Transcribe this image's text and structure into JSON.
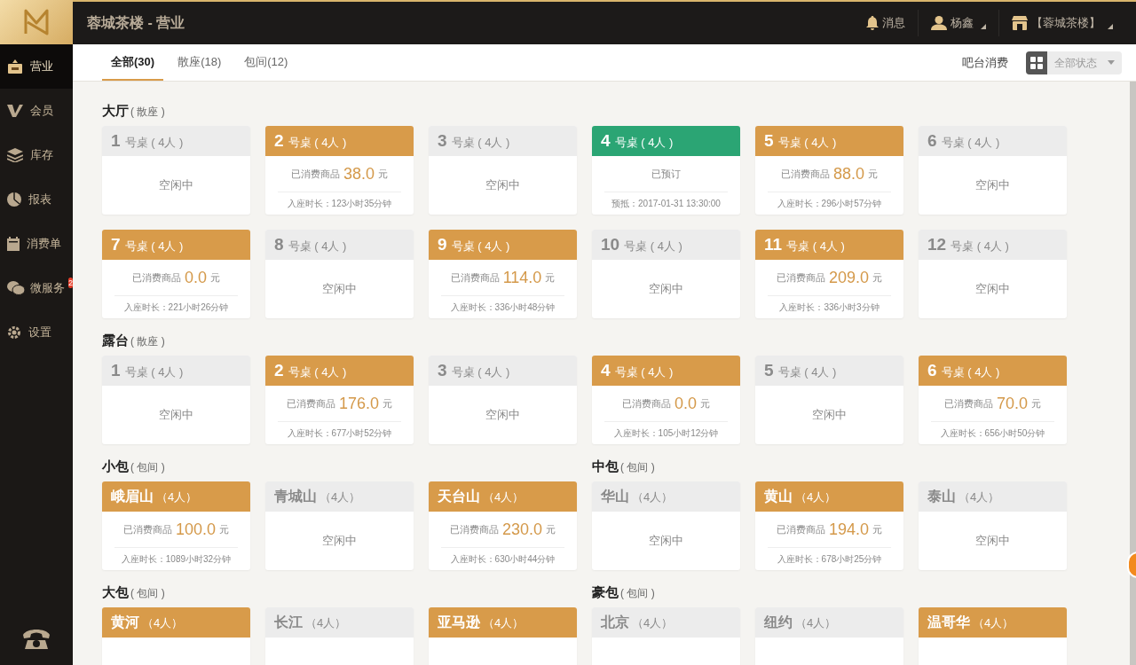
{
  "app": {
    "title": "蓉城茶楼 - 营业"
  },
  "header_menu": [
    {
      "kind": "bell",
      "label": "消息",
      "dropdown": false
    },
    {
      "kind": "user",
      "label": "杨鑫",
      "dropdown": true
    },
    {
      "kind": "store",
      "label": "【蓉城茶楼】",
      "dropdown": true
    }
  ],
  "sidebar": {
    "items": [
      {
        "label": "营业",
        "selected": true
      },
      {
        "label": "会员",
        "selected": false
      },
      {
        "label": "库存",
        "selected": false
      },
      {
        "label": "报表",
        "selected": false
      },
      {
        "label": "消费单",
        "selected": false
      },
      {
        "label": "微服务",
        "selected": false,
        "badge": "2"
      },
      {
        "label": "设置",
        "selected": false
      }
    ]
  },
  "tabs": [
    {
      "label": "全部(30)",
      "selected": true
    },
    {
      "label": "散座(18)",
      "selected": false
    },
    {
      "label": "包间(12)",
      "selected": false
    }
  ],
  "toolbar": {
    "bar_link": "吧台消费",
    "status_select": "全部状态"
  },
  "rows": [
    {
      "sections": [
        {
          "name": "大厅",
          "type": "( 散座 )",
          "tables": [
            {
              "kind": "numbered",
              "number": "1",
              "label": "号桌",
              "capacity": "( 4人 )",
              "occupied": false,
              "reserved": false,
              "text": "空闲中"
            },
            {
              "kind": "numbered",
              "number": "2",
              "label": "号桌",
              "capacity": "( 4人 )",
              "occupied": true,
              "reserved": false,
              "text": "已消费商品",
              "amount": "38.0",
              "unit": "元",
              "duration": "入座时长：123小时35分钟"
            },
            {
              "kind": "numbered",
              "number": "3",
              "label": "号桌",
              "capacity": "( 4人 )",
              "occupied": false,
              "reserved": false,
              "text": "空闲中"
            },
            {
              "kind": "numbered",
              "number": "4",
              "label": "号桌",
              "capacity": "( 4人 )",
              "occupied": false,
              "reserved": true,
              "text": "已预订",
              "duration": "预抵：2017-01-31 13:30:00"
            },
            {
              "kind": "numbered",
              "number": "5",
              "label": "号桌",
              "capacity": "( 4人 )",
              "occupied": true,
              "reserved": false,
              "text": "已消费商品",
              "amount": "88.0",
              "unit": "元",
              "duration": "入座时长：296小时57分钟"
            },
            {
              "kind": "numbered",
              "number": "6",
              "label": "号桌",
              "capacity": "( 4人 )",
              "occupied": false,
              "reserved": false,
              "text": "空闲中"
            },
            {
              "kind": "numbered",
              "number": "7",
              "label": "号桌",
              "capacity": "( 4人 )",
              "occupied": true,
              "reserved": false,
              "text": "已消费商品",
              "amount": "0.0",
              "unit": "元",
              "duration": "入座时长：221小时26分钟"
            },
            {
              "kind": "numbered",
              "number": "8",
              "label": "号桌",
              "capacity": "( 4人 )",
              "occupied": false,
              "reserved": false,
              "text": "空闲中"
            },
            {
              "kind": "numbered",
              "number": "9",
              "label": "号桌",
              "capacity": "( 4人 )",
              "occupied": true,
              "reserved": false,
              "text": "已消费商品",
              "amount": "114.0",
              "unit": "元",
              "duration": "入座时长：336小时48分钟"
            },
            {
              "kind": "numbered",
              "number": "10",
              "label": "号桌",
              "capacity": "( 4人 )",
              "occupied": false,
              "reserved": false,
              "text": "空闲中"
            },
            {
              "kind": "numbered",
              "number": "11",
              "label": "号桌",
              "capacity": "( 4人 )",
              "occupied": true,
              "reserved": false,
              "text": "已消费商品",
              "amount": "209.0",
              "unit": "元",
              "duration": "入座时长：336小时3分钟"
            },
            {
              "kind": "numbered",
              "number": "12",
              "label": "号桌",
              "capacity": "( 4人 )",
              "occupied": false,
              "reserved": false,
              "text": "空闲中"
            }
          ]
        }
      ]
    },
    {
      "sections": [
        {
          "name": "露台",
          "type": "( 散座 )",
          "tables": [
            {
              "kind": "numbered",
              "number": "1",
              "label": "号桌",
              "capacity": "( 4人 )",
              "occupied": false,
              "reserved": false,
              "text": "空闲中"
            },
            {
              "kind": "numbered",
              "number": "2",
              "label": "号桌",
              "capacity": "( 4人 )",
              "occupied": true,
              "reserved": false,
              "text": "已消费商品",
              "amount": "176.0",
              "unit": "元",
              "duration": "入座时长：677小时52分钟"
            },
            {
              "kind": "numbered",
              "number": "3",
              "label": "号桌",
              "capacity": "( 4人 )",
              "occupied": false,
              "reserved": false,
              "text": "空闲中"
            },
            {
              "kind": "numbered",
              "number": "4",
              "label": "号桌",
              "capacity": "( 4人 )",
              "occupied": true,
              "reserved": false,
              "text": "已消费商品",
              "amount": "0.0",
              "unit": "元",
              "duration": "入座时长：105小时12分钟"
            },
            {
              "kind": "numbered",
              "number": "5",
              "label": "号桌",
              "capacity": "( 4人 )",
              "occupied": false,
              "reserved": false,
              "text": "空闲中"
            },
            {
              "kind": "numbered",
              "number": "6",
              "label": "号桌",
              "capacity": "( 4人 )",
              "occupied": true,
              "reserved": false,
              "text": "已消费商品",
              "amount": "70.0",
              "unit": "元",
              "duration": "入座时长：656小时50分钟"
            }
          ]
        }
      ]
    },
    {
      "sections": [
        {
          "name": "小包",
          "type": "( 包间 )",
          "tables": [
            {
              "kind": "room",
              "label": "峨眉山",
              "capacity": "（4人）",
              "occupied": true,
              "reserved": false,
              "text": "已消费商品",
              "amount": "100.0",
              "unit": "元",
              "duration": "入座时长：1089小时32分钟"
            },
            {
              "kind": "room",
              "label": "青城山",
              "capacity": "（4人）",
              "occupied": false,
              "reserved": false,
              "text": "空闲中"
            },
            {
              "kind": "room",
              "label": "天台山",
              "capacity": "（4人）",
              "occupied": true,
              "reserved": false,
              "text": "已消费商品",
              "amount": "230.0",
              "unit": "元",
              "duration": "入座时长：630小时44分钟"
            }
          ]
        },
        {
          "name": "中包",
          "type": "( 包间 )",
          "tables": [
            {
              "kind": "room",
              "label": "华山",
              "capacity": "（4人）",
              "occupied": false,
              "reserved": false,
              "text": "空闲中"
            },
            {
              "kind": "room",
              "label": "黄山",
              "capacity": "（4人）",
              "occupied": true,
              "reserved": false,
              "text": "已消费商品",
              "amount": "194.0",
              "unit": "元",
              "duration": "入座时长：678小时25分钟"
            },
            {
              "kind": "room",
              "label": "泰山",
              "capacity": "（4人）",
              "occupied": false,
              "reserved": false,
              "text": "空闲中"
            }
          ]
        }
      ]
    },
    {
      "sections": [
        {
          "name": "大包",
          "type": "( 包间 )",
          "tables": [
            {
              "kind": "room",
              "label": "黄河",
              "capacity": "（4人）",
              "occupied": true,
              "reserved": false
            },
            {
              "kind": "room",
              "label": "长江",
              "capacity": "（4人）",
              "occupied": false,
              "reserved": false
            },
            {
              "kind": "room",
              "label": "亚马逊",
              "capacity": "（4人）",
              "occupied": true,
              "reserved": false
            }
          ]
        },
        {
          "name": "豪包",
          "type": "( 包间 )",
          "tables": [
            {
              "kind": "room",
              "label": "北京",
              "capacity": "（4人）",
              "occupied": false,
              "reserved": false
            },
            {
              "kind": "room",
              "label": "纽约",
              "capacity": "（4人）",
              "occupied": false,
              "reserved": false
            },
            {
              "kind": "room",
              "label": "温哥华",
              "capacity": "（4人）",
              "occupied": true,
              "reserved": false
            }
          ]
        }
      ]
    }
  ]
}
